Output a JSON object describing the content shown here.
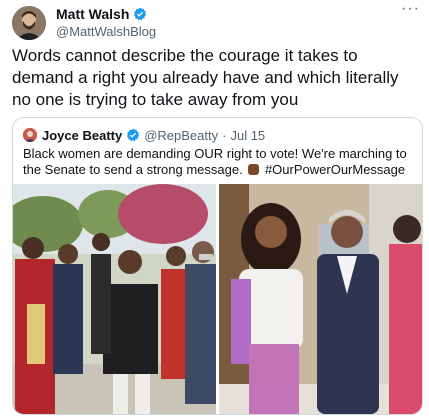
{
  "tweet": {
    "author_name": "Matt Walsh",
    "author_handle": "@MattWalshBlog",
    "text": "Words cannot describe the courage it takes to demand a right you already have and which literally no one is trying to take away from you",
    "more_label": "···"
  },
  "quoted": {
    "author_name": "Joyce Beatty",
    "author_handle": "@RepBeatty",
    "separator": "·",
    "date": "Jul 15",
    "text_before": "Black women are demanding OUR right to vote! We're marching to the Senate to send a strong message.",
    "text_after": "#OurPowerOurMessage",
    "emoji": "raised-fist-emoji"
  },
  "icons": {
    "verified": "verified-badge-icon",
    "more": "more-options-icon"
  },
  "colors": {
    "verified_blue": "#1d9bf0",
    "secondary_text": "#536471",
    "border": "#cfd9de"
  },
  "photos": [
    {
      "label": "march-photo"
    },
    {
      "label": "portrait-photo"
    }
  ]
}
